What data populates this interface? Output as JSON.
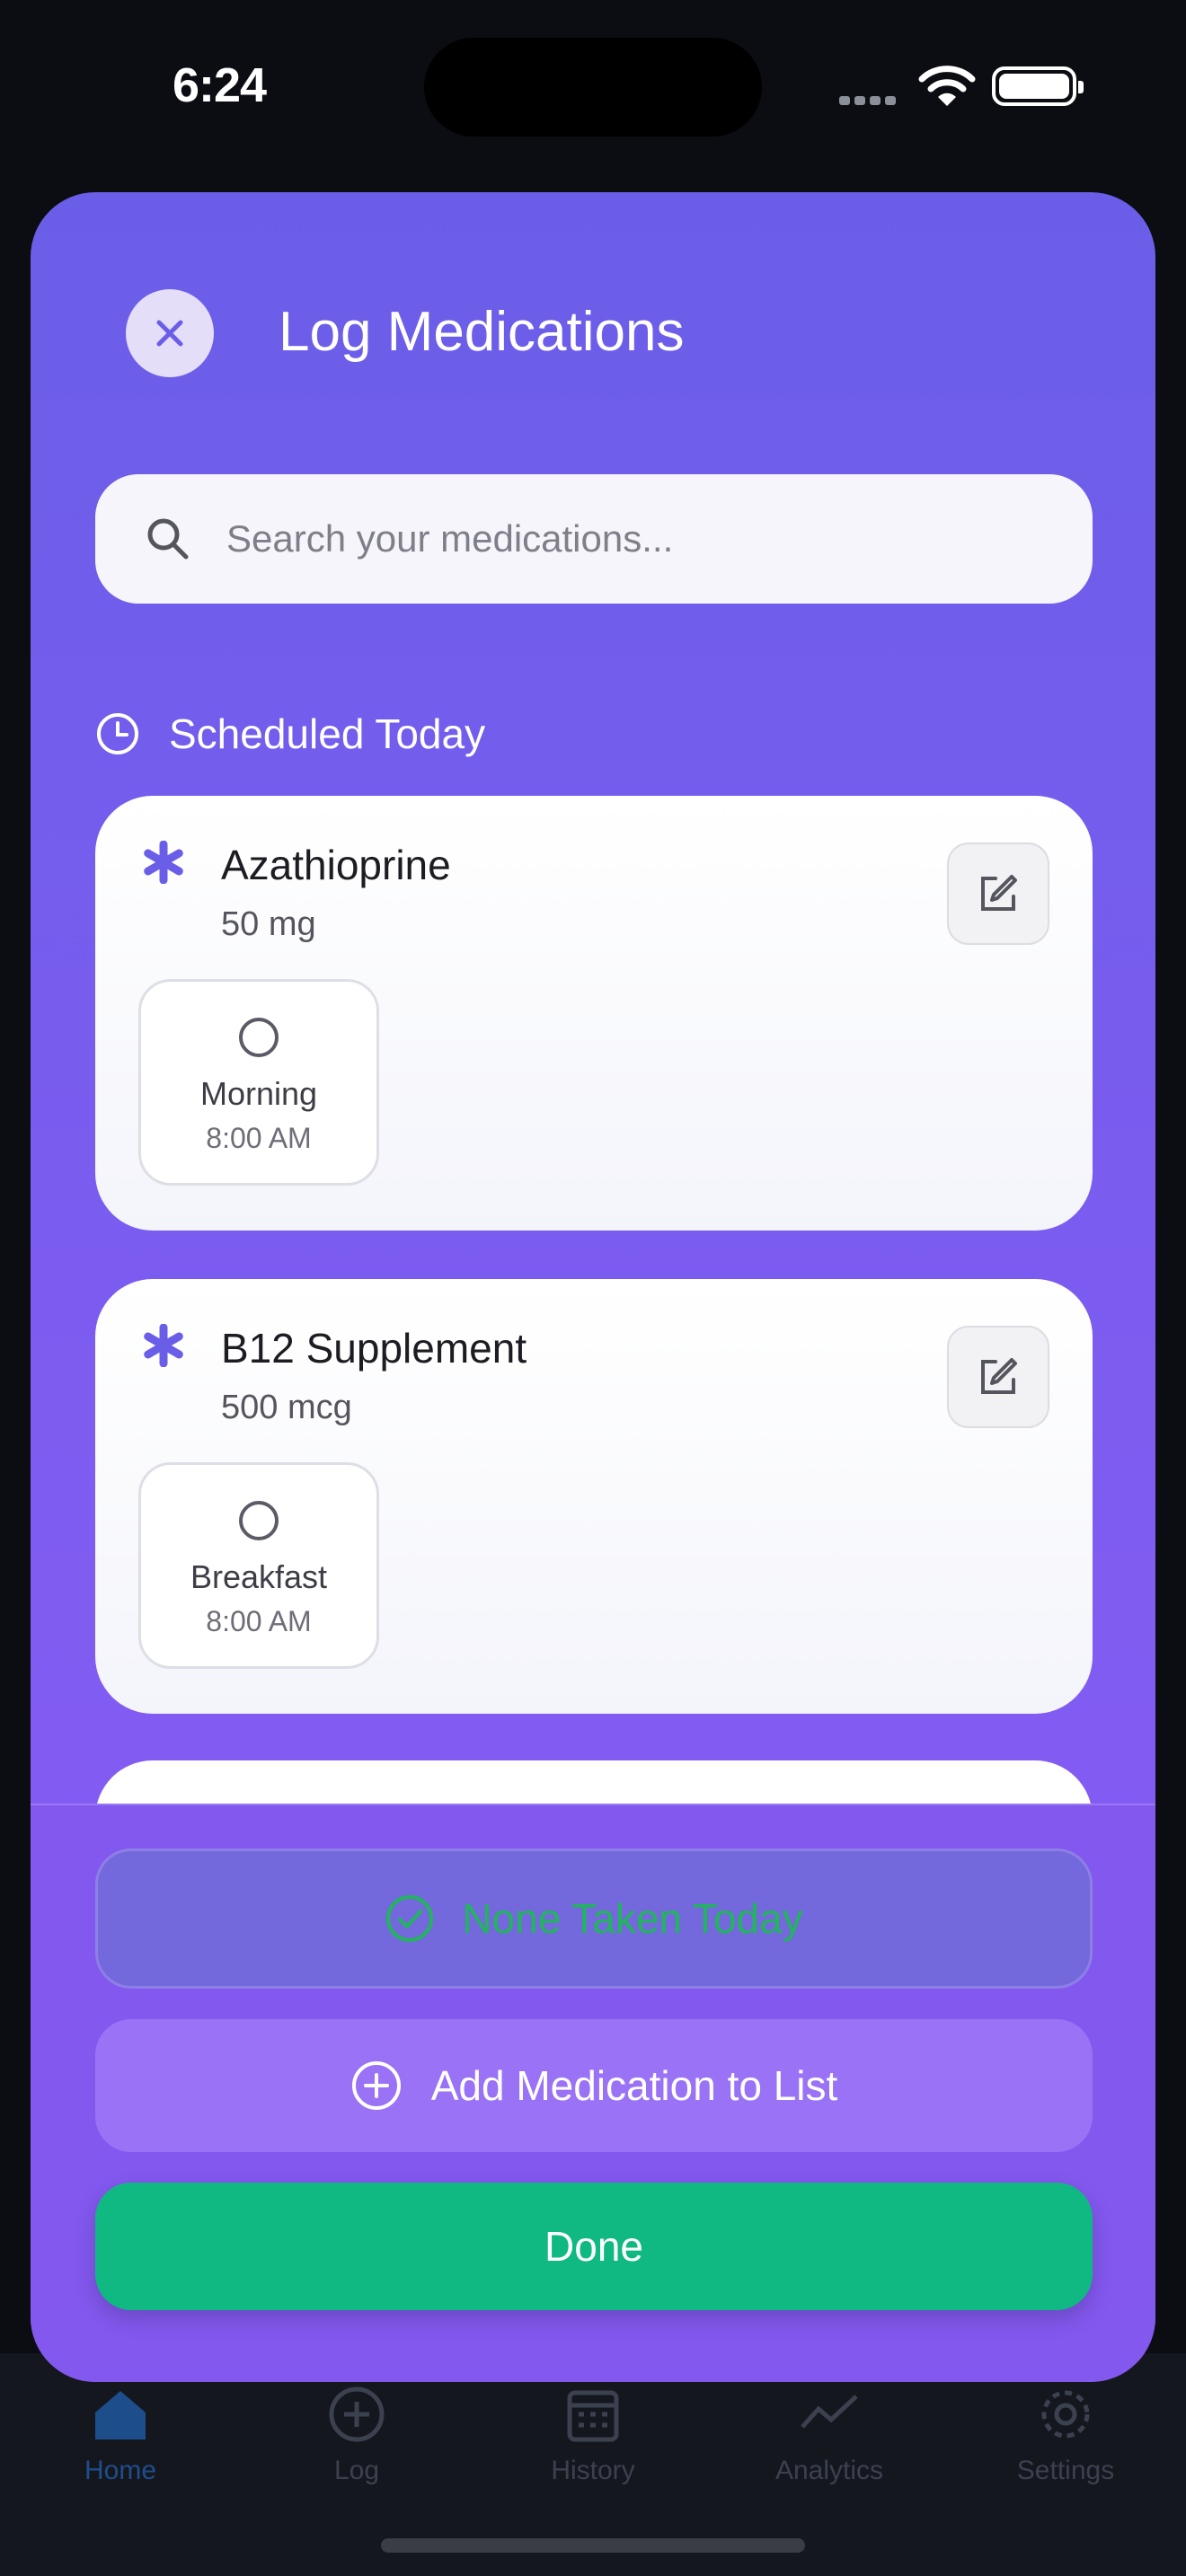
{
  "status_bar": {
    "time": "6:24"
  },
  "tab_bar": {
    "tabs": [
      {
        "label": "Home",
        "icon": "home-icon",
        "active": true
      },
      {
        "label": "Log",
        "icon": "plus-circle-icon",
        "active": false
      },
      {
        "label": "History",
        "icon": "calendar-icon",
        "active": false
      },
      {
        "label": "Analytics",
        "icon": "chart-line-icon",
        "active": false
      },
      {
        "label": "Settings",
        "icon": "gear-icon",
        "active": false
      }
    ]
  },
  "modal": {
    "title": "Log Medications",
    "search": {
      "placeholder": "Search your medications...",
      "value": ""
    },
    "section_title": "Scheduled Today",
    "medications": [
      {
        "name": "Azathioprine",
        "dose": "50 mg",
        "slots": [
          {
            "label": "Morning",
            "time": "8:00 AM",
            "taken": false
          }
        ]
      },
      {
        "name": "B12 Supplement",
        "dose": "500 mcg",
        "slots": [
          {
            "label": "Breakfast",
            "time": "8:00 AM",
            "taken": false
          }
        ]
      }
    ],
    "buttons": {
      "none_taken": "None Taken Today",
      "add_medication": "Add Medication to List",
      "done": "Done"
    }
  },
  "colors": {
    "accent": "#7c5cf0",
    "done_green": "#10b981",
    "none_taken_text": "#22b45e",
    "medication_icon": "#6a5ee8"
  }
}
